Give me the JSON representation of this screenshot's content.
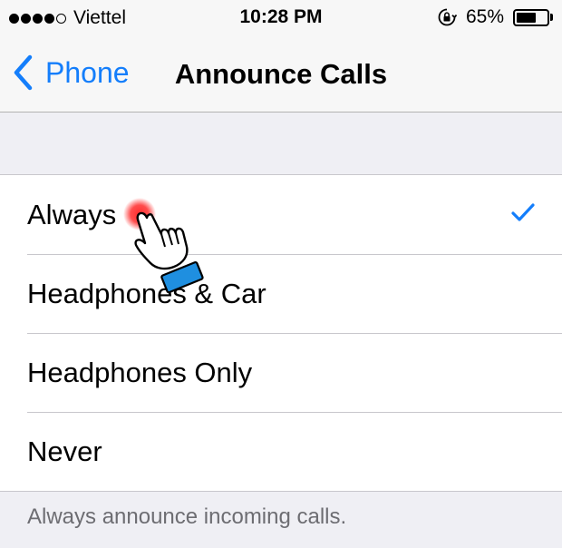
{
  "status_bar": {
    "carrier": "Viettel",
    "signal_bars_filled": 4,
    "signal_bars_total": 5,
    "time": "10:28 PM",
    "battery_percent": "65%",
    "battery_level": 0.65
  },
  "nav": {
    "back_label": "Phone",
    "title": "Announce Calls"
  },
  "options": [
    {
      "label": "Always",
      "selected": true
    },
    {
      "label": "Headphones & Car",
      "selected": false
    },
    {
      "label": "Headphones Only",
      "selected": false
    },
    {
      "label": "Never",
      "selected": false
    }
  ],
  "footer": "Always announce incoming calls.",
  "colors": {
    "accent": "#147efb",
    "background": "#efeff4",
    "tap_indicator": "#ff2d2d"
  }
}
